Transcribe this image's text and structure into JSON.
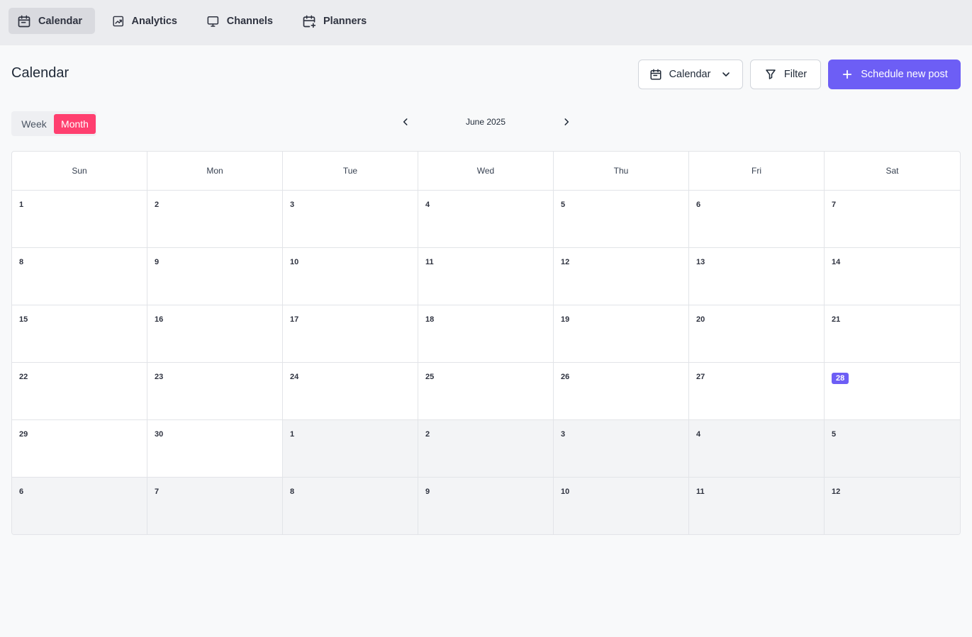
{
  "nav": {
    "items": [
      {
        "label": "Calendar",
        "icon": "calendar-icon",
        "active": true
      },
      {
        "label": "Analytics",
        "icon": "analytics-chart-icon",
        "active": false
      },
      {
        "label": "Channels",
        "icon": "monitor-icon",
        "active": false
      },
      {
        "label": "Planners",
        "icon": "calendar-add-icon",
        "active": false
      }
    ]
  },
  "page": {
    "title": "Calendar"
  },
  "toolbar": {
    "calendar_select_label": "Calendar",
    "filter_label": "Filter",
    "schedule_label": "Schedule new post"
  },
  "view": {
    "week_label": "Week",
    "month_label": "Month",
    "selected": "Month"
  },
  "month_nav": {
    "label": "June 2025"
  },
  "calendar": {
    "weekdays": [
      "Sun",
      "Mon",
      "Tue",
      "Wed",
      "Thu",
      "Fri",
      "Sat"
    ],
    "today": 28,
    "weeks": [
      [
        "1",
        "2",
        "3",
        "4",
        "5",
        "6",
        "7"
      ],
      [
        "8",
        "9",
        "10",
        "11",
        "12",
        "13",
        "14"
      ],
      [
        "15",
        "16",
        "17",
        "18",
        "19",
        "20",
        "21"
      ],
      [
        "22",
        "23",
        "24",
        "25",
        "26",
        "27",
        "28"
      ],
      [
        "29",
        "30",
        "1",
        "2",
        "3",
        "4",
        "5"
      ],
      [
        "6",
        "7",
        "8",
        "9",
        "10",
        "11",
        "12"
      ]
    ],
    "outside_month": [
      [
        false,
        false,
        false,
        false,
        false,
        false,
        false
      ],
      [
        false,
        false,
        false,
        false,
        false,
        false,
        false
      ],
      [
        false,
        false,
        false,
        false,
        false,
        false,
        false
      ],
      [
        false,
        false,
        false,
        false,
        false,
        false,
        false
      ],
      [
        false,
        false,
        true,
        true,
        true,
        true,
        true
      ],
      [
        true,
        true,
        true,
        true,
        true,
        true,
        true
      ]
    ]
  },
  "colors": {
    "accent": "#6d5ef5",
    "month_toggle": "#ff3f6f",
    "nav_background": "#ebecef",
    "outside_month_cell": "#f3f4f6"
  }
}
